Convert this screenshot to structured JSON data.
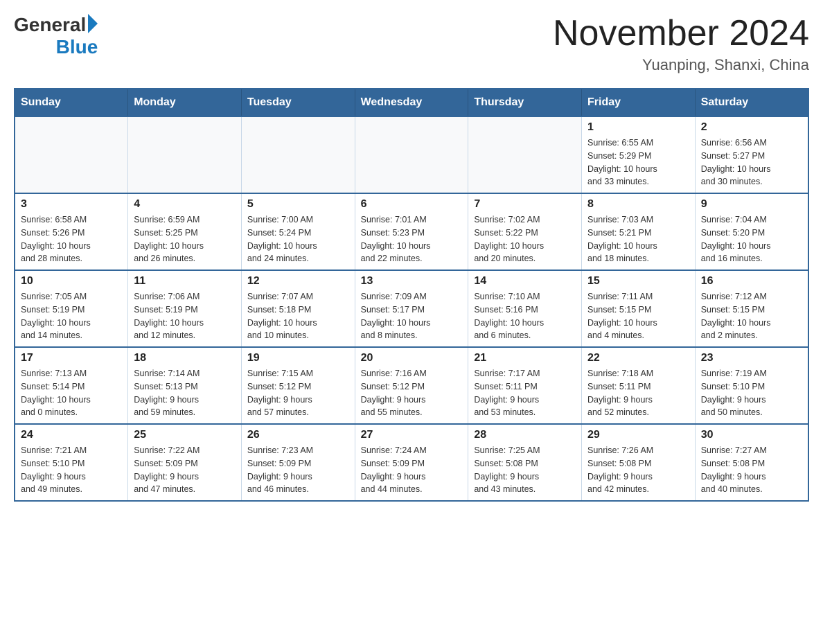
{
  "header": {
    "logo_general": "General",
    "logo_blue": "Blue",
    "month_title": "November 2024",
    "subtitle": "Yuanping, Shanxi, China"
  },
  "days_of_week": [
    "Sunday",
    "Monday",
    "Tuesday",
    "Wednesday",
    "Thursday",
    "Friday",
    "Saturday"
  ],
  "weeks": [
    [
      {
        "day": "",
        "info": ""
      },
      {
        "day": "",
        "info": ""
      },
      {
        "day": "",
        "info": ""
      },
      {
        "day": "",
        "info": ""
      },
      {
        "day": "",
        "info": ""
      },
      {
        "day": "1",
        "info": "Sunrise: 6:55 AM\nSunset: 5:29 PM\nDaylight: 10 hours\nand 33 minutes."
      },
      {
        "day": "2",
        "info": "Sunrise: 6:56 AM\nSunset: 5:27 PM\nDaylight: 10 hours\nand 30 minutes."
      }
    ],
    [
      {
        "day": "3",
        "info": "Sunrise: 6:58 AM\nSunset: 5:26 PM\nDaylight: 10 hours\nand 28 minutes."
      },
      {
        "day": "4",
        "info": "Sunrise: 6:59 AM\nSunset: 5:25 PM\nDaylight: 10 hours\nand 26 minutes."
      },
      {
        "day": "5",
        "info": "Sunrise: 7:00 AM\nSunset: 5:24 PM\nDaylight: 10 hours\nand 24 minutes."
      },
      {
        "day": "6",
        "info": "Sunrise: 7:01 AM\nSunset: 5:23 PM\nDaylight: 10 hours\nand 22 minutes."
      },
      {
        "day": "7",
        "info": "Sunrise: 7:02 AM\nSunset: 5:22 PM\nDaylight: 10 hours\nand 20 minutes."
      },
      {
        "day": "8",
        "info": "Sunrise: 7:03 AM\nSunset: 5:21 PM\nDaylight: 10 hours\nand 18 minutes."
      },
      {
        "day": "9",
        "info": "Sunrise: 7:04 AM\nSunset: 5:20 PM\nDaylight: 10 hours\nand 16 minutes."
      }
    ],
    [
      {
        "day": "10",
        "info": "Sunrise: 7:05 AM\nSunset: 5:19 PM\nDaylight: 10 hours\nand 14 minutes."
      },
      {
        "day": "11",
        "info": "Sunrise: 7:06 AM\nSunset: 5:19 PM\nDaylight: 10 hours\nand 12 minutes."
      },
      {
        "day": "12",
        "info": "Sunrise: 7:07 AM\nSunset: 5:18 PM\nDaylight: 10 hours\nand 10 minutes."
      },
      {
        "day": "13",
        "info": "Sunrise: 7:09 AM\nSunset: 5:17 PM\nDaylight: 10 hours\nand 8 minutes."
      },
      {
        "day": "14",
        "info": "Sunrise: 7:10 AM\nSunset: 5:16 PM\nDaylight: 10 hours\nand 6 minutes."
      },
      {
        "day": "15",
        "info": "Sunrise: 7:11 AM\nSunset: 5:15 PM\nDaylight: 10 hours\nand 4 minutes."
      },
      {
        "day": "16",
        "info": "Sunrise: 7:12 AM\nSunset: 5:15 PM\nDaylight: 10 hours\nand 2 minutes."
      }
    ],
    [
      {
        "day": "17",
        "info": "Sunrise: 7:13 AM\nSunset: 5:14 PM\nDaylight: 10 hours\nand 0 minutes."
      },
      {
        "day": "18",
        "info": "Sunrise: 7:14 AM\nSunset: 5:13 PM\nDaylight: 9 hours\nand 59 minutes."
      },
      {
        "day": "19",
        "info": "Sunrise: 7:15 AM\nSunset: 5:12 PM\nDaylight: 9 hours\nand 57 minutes."
      },
      {
        "day": "20",
        "info": "Sunrise: 7:16 AM\nSunset: 5:12 PM\nDaylight: 9 hours\nand 55 minutes."
      },
      {
        "day": "21",
        "info": "Sunrise: 7:17 AM\nSunset: 5:11 PM\nDaylight: 9 hours\nand 53 minutes."
      },
      {
        "day": "22",
        "info": "Sunrise: 7:18 AM\nSunset: 5:11 PM\nDaylight: 9 hours\nand 52 minutes."
      },
      {
        "day": "23",
        "info": "Sunrise: 7:19 AM\nSunset: 5:10 PM\nDaylight: 9 hours\nand 50 minutes."
      }
    ],
    [
      {
        "day": "24",
        "info": "Sunrise: 7:21 AM\nSunset: 5:10 PM\nDaylight: 9 hours\nand 49 minutes."
      },
      {
        "day": "25",
        "info": "Sunrise: 7:22 AM\nSunset: 5:09 PM\nDaylight: 9 hours\nand 47 minutes."
      },
      {
        "day": "26",
        "info": "Sunrise: 7:23 AM\nSunset: 5:09 PM\nDaylight: 9 hours\nand 46 minutes."
      },
      {
        "day": "27",
        "info": "Sunrise: 7:24 AM\nSunset: 5:09 PM\nDaylight: 9 hours\nand 44 minutes."
      },
      {
        "day": "28",
        "info": "Sunrise: 7:25 AM\nSunset: 5:08 PM\nDaylight: 9 hours\nand 43 minutes."
      },
      {
        "day": "29",
        "info": "Sunrise: 7:26 AM\nSunset: 5:08 PM\nDaylight: 9 hours\nand 42 minutes."
      },
      {
        "day": "30",
        "info": "Sunrise: 7:27 AM\nSunset: 5:08 PM\nDaylight: 9 hours\nand 40 minutes."
      }
    ]
  ]
}
